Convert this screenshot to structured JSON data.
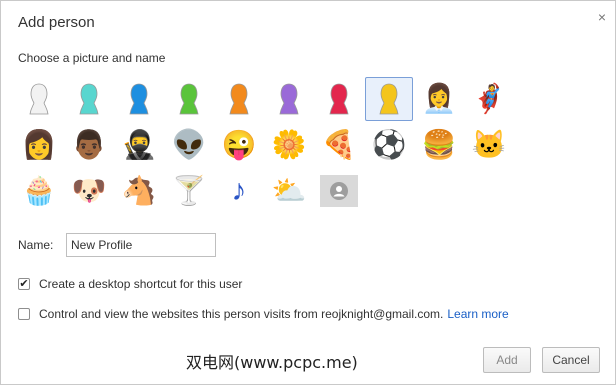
{
  "dialog": {
    "title": "Add person",
    "close_icon": "×",
    "subtitle": "Choose a picture and name"
  },
  "avatars": [
    {
      "name": "avatar-white-silhouette",
      "icon": "white-silhouette",
      "color": "#f2f2f2"
    },
    {
      "name": "avatar-teal-silhouette",
      "icon": "teal-silhouette",
      "color": "#59d6cf"
    },
    {
      "name": "avatar-blue-silhouette",
      "icon": "blue-silhouette",
      "color": "#1e8fe0"
    },
    {
      "name": "avatar-green-silhouette",
      "icon": "green-silhouette",
      "color": "#5ac43b"
    },
    {
      "name": "avatar-orange-silhouette",
      "icon": "orange-silhouette",
      "color": "#f28a1d"
    },
    {
      "name": "avatar-purple-silhouette",
      "icon": "purple-silhouette",
      "color": "#9a6ad8"
    },
    {
      "name": "avatar-red-silhouette",
      "icon": "red-silhouette",
      "color": "#e3264d"
    },
    {
      "name": "avatar-yellow-silhouette",
      "icon": "yellow-silhouette",
      "color": "#f4c51c",
      "selected": true
    },
    {
      "name": "avatar-businesswoman",
      "icon": "businesswoman",
      "glyph": "👩‍💼"
    },
    {
      "name": "avatar-superhero",
      "icon": "superhero",
      "glyph": "🦸"
    },
    {
      "name": "avatar-woman-sunglasses",
      "icon": "woman-sunglasses",
      "glyph": "👩"
    },
    {
      "name": "avatar-man",
      "icon": "man",
      "glyph": "👨🏾"
    },
    {
      "name": "avatar-ninja",
      "icon": "ninja",
      "glyph": "🥷"
    },
    {
      "name": "avatar-alien",
      "icon": "alien",
      "glyph": "👽"
    },
    {
      "name": "avatar-smiley",
      "icon": "smiley",
      "glyph": "😜"
    },
    {
      "name": "avatar-flower",
      "icon": "flower",
      "glyph": "🌼"
    },
    {
      "name": "avatar-pizza",
      "icon": "pizza",
      "glyph": "🍕"
    },
    {
      "name": "avatar-soccer-ball",
      "icon": "soccer-ball",
      "glyph": "⚽"
    },
    {
      "name": "avatar-burger",
      "icon": "burger",
      "glyph": "🍔"
    },
    {
      "name": "avatar-cat",
      "icon": "cat",
      "glyph": "🐱"
    },
    {
      "name": "avatar-cupcake",
      "icon": "cupcake",
      "glyph": "🧁"
    },
    {
      "name": "avatar-dog",
      "icon": "dog",
      "glyph": "🐶"
    },
    {
      "name": "avatar-horse",
      "icon": "horse",
      "glyph": "🐴"
    },
    {
      "name": "avatar-cocktail",
      "icon": "cocktail",
      "glyph": "🍸"
    },
    {
      "name": "avatar-music-note",
      "icon": "music-note",
      "glyph": "♪"
    },
    {
      "name": "avatar-sun-cloud",
      "icon": "sun-cloud",
      "glyph": "⛅"
    },
    {
      "name": "avatar-generic-person",
      "icon": "generic-person",
      "placeholder": true
    }
  ],
  "name_field": {
    "label": "Name:",
    "value": "New Profile"
  },
  "desktop_shortcut": {
    "label": "Create a desktop shortcut for this user",
    "checked": true,
    "check_glyph": "✔"
  },
  "supervise": {
    "label": "Control and view the websites this person visits from reojknight@gmail.com.",
    "link": "Learn more",
    "checked": false
  },
  "watermark": "双电网(www.pcpc.me)",
  "buttons": {
    "add": "Add",
    "cancel": "Cancel"
  }
}
